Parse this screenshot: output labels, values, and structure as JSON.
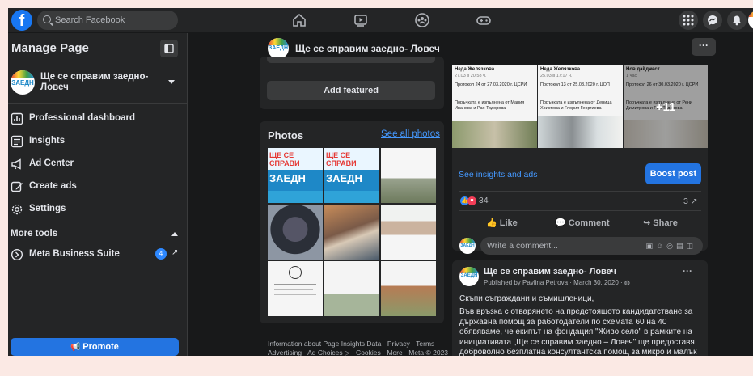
{
  "topbar": {
    "logo": "f",
    "search_placeholder": "Search Facebook",
    "nav_icons": [
      "home-icon",
      "watch-icon",
      "groups-icon",
      "gaming-icon"
    ],
    "right_icons": [
      "menu-grid-icon",
      "messenger-icon",
      "notifications-icon"
    ]
  },
  "sidebar": {
    "title": "Manage Page",
    "page_name": "Ще се справим заедно- Ловеч",
    "items": [
      {
        "label": "Professional dashboard",
        "icon": "dashboard-icon"
      },
      {
        "label": "Insights",
        "icon": "insights-icon"
      },
      {
        "label": "Ad Center",
        "icon": "megaphone-icon"
      },
      {
        "label": "Create ads",
        "icon": "pencil-icon"
      },
      {
        "label": "Settings",
        "icon": "gear-icon"
      }
    ],
    "more_tools": "More tools",
    "meta_suite": {
      "label": "Meta Business Suite",
      "badge": "4"
    },
    "promote": "Promote"
  },
  "header": {
    "page_name": "Ще се справим заедно- Ловеч",
    "more": "···"
  },
  "left": {
    "add_featured": "Add featured",
    "photos_title": "Photos",
    "see_all": "See all photos",
    "footer": "Information about Page Insights Data · Privacy · Terms · Advertising · Ad Choices ▷ · Cookies · More · Meta © 2023"
  },
  "post1": {
    "thumbs": [
      {
        "name": "Неда Желязкова",
        "date": "27.03 в 20:58 ч.",
        "text": "Протокол 24 от 27.03.2020 г. ЦСРИ",
        "note": "Поръчката е изпълнена от Мария Иванова и Рая Тодорова"
      },
      {
        "name": "Неда Желязкова",
        "date": "25.03 в 17:17 ч.",
        "text": "Протокол 13 от 25.03.2020 г. ЦОП",
        "note": "Поръчката е изпълнена от Деница Христова и Глория Георгиева"
      },
      {
        "name": "Нов дайджест",
        "date": "1 час",
        "text": "Протокол 26 от 30.03.2020 г. ЦСРИ",
        "note": "Поръчката е изпълнена от Рени Димитрова и Рая Тодорова",
        "overlay": "+11"
      }
    ],
    "see_insights": "See insights and ads",
    "boost": "Boost post",
    "reactions": "34",
    "shares": "3",
    "like": "Like",
    "comment": "Comment",
    "share": "Share",
    "comment_placeholder": "Write a comment..."
  },
  "post2": {
    "name": "Ще се справим заедно- Ловеч",
    "meta": "Published by Pavlina Petrova · March 30, 2020 ·",
    "greeting": "Скъпи съграждани и съмишленици,",
    "body": "Във връзка с отварянето на предстоящото кандидатстване за държавна помощ за работодатели по схемата 60 на 40 обявяваме, че екипът на фондация \"Живо село\" в рамките на инициативата „Ще се справим заедно – Ловеч\" ще предоставя доброволно безплатна консултантска помощ за микро и малък бизнес",
    "more": "···"
  },
  "colors": {
    "accent": "#2374e1",
    "link": "#4599ff",
    "surface": "#242526",
    "background": "#18191a",
    "reaction_like": "#2d88ff",
    "reaction_love": "#f33e58"
  },
  "avatar_text": "ЗАЕДН"
}
